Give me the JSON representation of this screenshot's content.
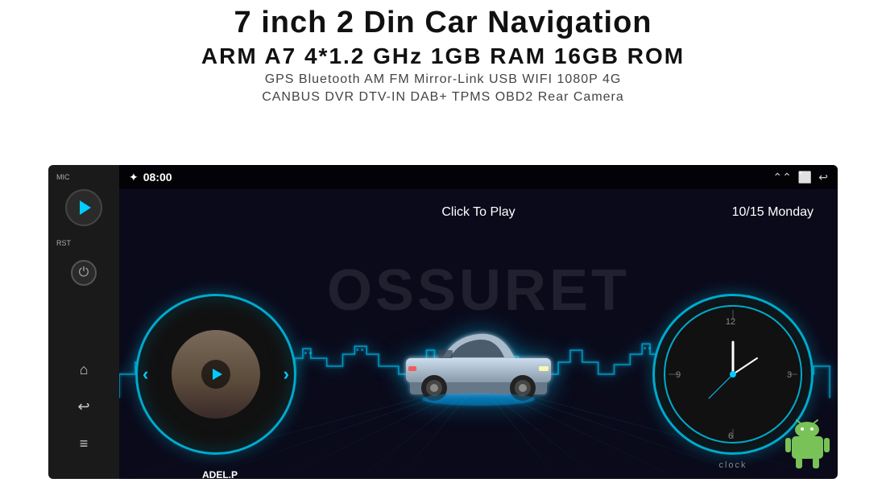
{
  "header": {
    "main_title": "7 inch 2 Din Car Navigation",
    "specs": "ARM A7 4*1.2 GHz    1GB RAM    16GB ROM",
    "features_line1": "GPS  Bluetooth  AM  FM  Mirror-Link  USB  WIFI  1080P  4G",
    "features_line2": "CANBUS   DVR   DTV-IN   DAB+   TPMS   OBD2   Rear Camera"
  },
  "status_bar": {
    "bluetooth_icon": "✦",
    "time": "08:00",
    "icons": [
      "⌃⌃",
      "⬜",
      "↩"
    ]
  },
  "screen": {
    "click_to_play": "Click To Play",
    "date": "10/15 Monday",
    "artist": "ADEL.P",
    "clock_label": "clock",
    "watermark": "OSSURET"
  },
  "physical_unit": {
    "mic_label": "MIC",
    "rst_label": "RST",
    "power_icon": "⏻",
    "home_icon": "⌂",
    "back_icon": "↩",
    "menu_icon": "≡"
  },
  "colors": {
    "accent": "#00ccff",
    "bg_dark": "#0a0a1a",
    "unit_bg": "#1a1a1a"
  }
}
